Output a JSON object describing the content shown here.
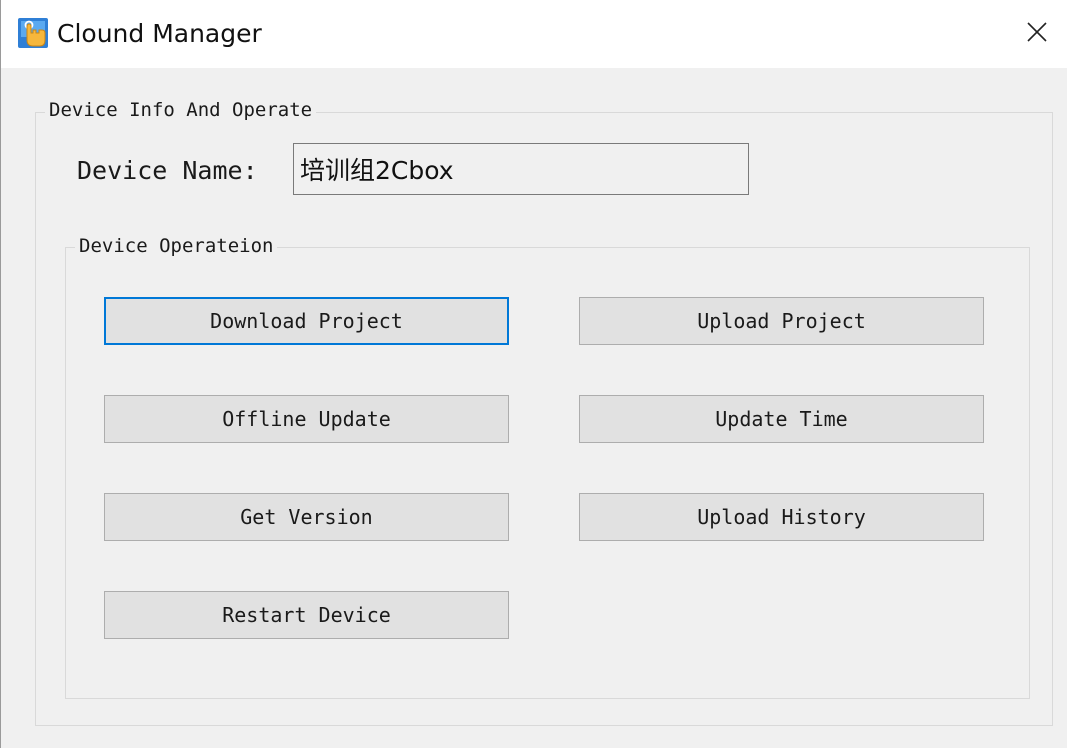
{
  "window": {
    "title": "Clound Manager",
    "icon": "app-hand-icon",
    "close_icon": "close-icon"
  },
  "device_info_group": {
    "legend": "Device Info And Operate",
    "device_name_label": "Device Name:",
    "device_name_value": "培训组2Cbox"
  },
  "operation_group": {
    "legend": "Device Operateion",
    "buttons": [
      {
        "label": "Download Project",
        "focused": true
      },
      {
        "label": "Upload Project"
      },
      {
        "label": "Offline Update"
      },
      {
        "label": "Update Time"
      },
      {
        "label": "Get Version"
      },
      {
        "label": "Upload History"
      },
      {
        "label": "Restart Device"
      }
    ]
  },
  "colors": {
    "focus_border": "#0078d7",
    "button_face": "#e1e1e1",
    "dialog_background": "#f0f0f0"
  }
}
